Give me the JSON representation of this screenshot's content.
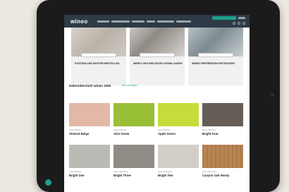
{
  "brand": "wineo",
  "tiles": [
    {
      "title": "KOSTENLOSE MUSTER BESTELLEN"
    },
    {
      "title": "WINEO 1500 BIM DATEN DOWNLOADEN"
    },
    {
      "title": "WINEO REFERENZEN ENTDECKEN"
    }
  ],
  "section": {
    "title": "Dekorübersicht wineo 1500",
    "link": "Alle anzeigen"
  },
  "decors": [
    {
      "meta": "wineo 1500 PL",
      "name": "Almond Beige",
      "color": "#e3b8a7"
    },
    {
      "meta": "wineo 1500 chip",
      "name": "Aloe Green",
      "color": "#99bf37"
    },
    {
      "meta": "wineo 1500 PL",
      "name": "Apple Green",
      "color": "#c6dc3a"
    },
    {
      "meta": "wineo 1500 chip",
      "name": "Bright Four",
      "color": "#665e56"
    },
    {
      "meta": "wineo 1500 PL",
      "name": "Bright One",
      "color": "#bcbab5"
    },
    {
      "meta": "wineo 1500 stone",
      "name": "Bright Three",
      "color": "#8f8c86"
    },
    {
      "meta": "wineo 1500 stone",
      "name": "Bright Two",
      "color": "#d2cec7"
    },
    {
      "meta": "wineo 1500 wood",
      "name": "Canyon Oak Honey",
      "color": "#b98453"
    }
  ],
  "colors": {
    "header": "#2e3a45",
    "accent": "#1f9e8e"
  }
}
